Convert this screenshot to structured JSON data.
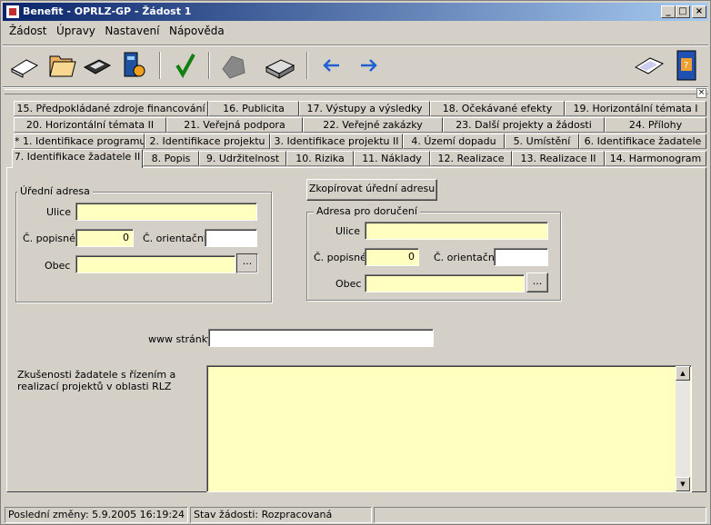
{
  "window": {
    "title": "Benefit - OPRLZ-GP - Žádost 1"
  },
  "menu": [
    {
      "label": "Žádost"
    },
    {
      "label": "Úpravy"
    },
    {
      "label": "Nastavení"
    },
    {
      "label": "Nápověda"
    }
  ],
  "toolbar": {
    "icons": [
      "new-document-icon",
      "open-folder-icon",
      "save-disk-icon",
      "transfer-icon",
      "check-icon",
      "stamp-icon",
      "print-icon",
      "back-arrow-icon",
      "forward-arrow-icon",
      "help-book-icon",
      "info-book-icon"
    ]
  },
  "tabs": {
    "row1": [
      "15. Předpokládané zdroje financování",
      "16. Publicita",
      "17. Výstupy a výsledky",
      "18. Očekávané efekty",
      "19. Horizontální témata I"
    ],
    "row2": [
      "20. Horizontální témata II",
      "21. Veřejná podpora",
      "22. Veřejné zakázky",
      "23. Další projekty a žádosti",
      "24. Přílohy"
    ],
    "row3": [
      "* 1. Identifikace programu",
      "2. Identifikace projektu",
      "3. Identifikace projektu II",
      "4. Území dopadu",
      "5. Umístění",
      "6. Identifikace žadatele"
    ],
    "row4": [
      "7. Identifikace žadatele II",
      "8. Popis",
      "9. Udržitelnost",
      "10. Rizika",
      "11. Náklady",
      "12. Realizace",
      "13. Realizace II",
      "14. Harmonogram"
    ]
  },
  "form": {
    "official_address": {
      "legend": "Úřední adresa",
      "street_label": "Ulice",
      "street_value": "",
      "house_no_label": "Č. popisné",
      "house_no_value": "0",
      "orient_no_label": "Č. orientační",
      "orient_no_value": "",
      "city_label": "Obec",
      "city_value": "",
      "browse_label": "..."
    },
    "copy_button": "Zkopírovat úřední adresu »",
    "delivery_address": {
      "legend": "Adresa pro doručení",
      "street_label": "Ulice",
      "street_value": "",
      "house_no_label": "Č. popisné",
      "house_no_value": "0",
      "orient_no_label": "Č. orientační",
      "orient_no_value": "",
      "city_label": "Obec",
      "city_value": "",
      "browse_label": "..."
    },
    "web_label": "www stránky",
    "web_value": "",
    "experience_label": "Zkušenosti žadatele s řízením a realizací projektů v oblasti RLZ",
    "experience_value": ""
  },
  "status": {
    "last_change": "Poslední změny: 5.9.2005 16:19:24",
    "state": "Stav žádosti: Rozpracovaná"
  }
}
